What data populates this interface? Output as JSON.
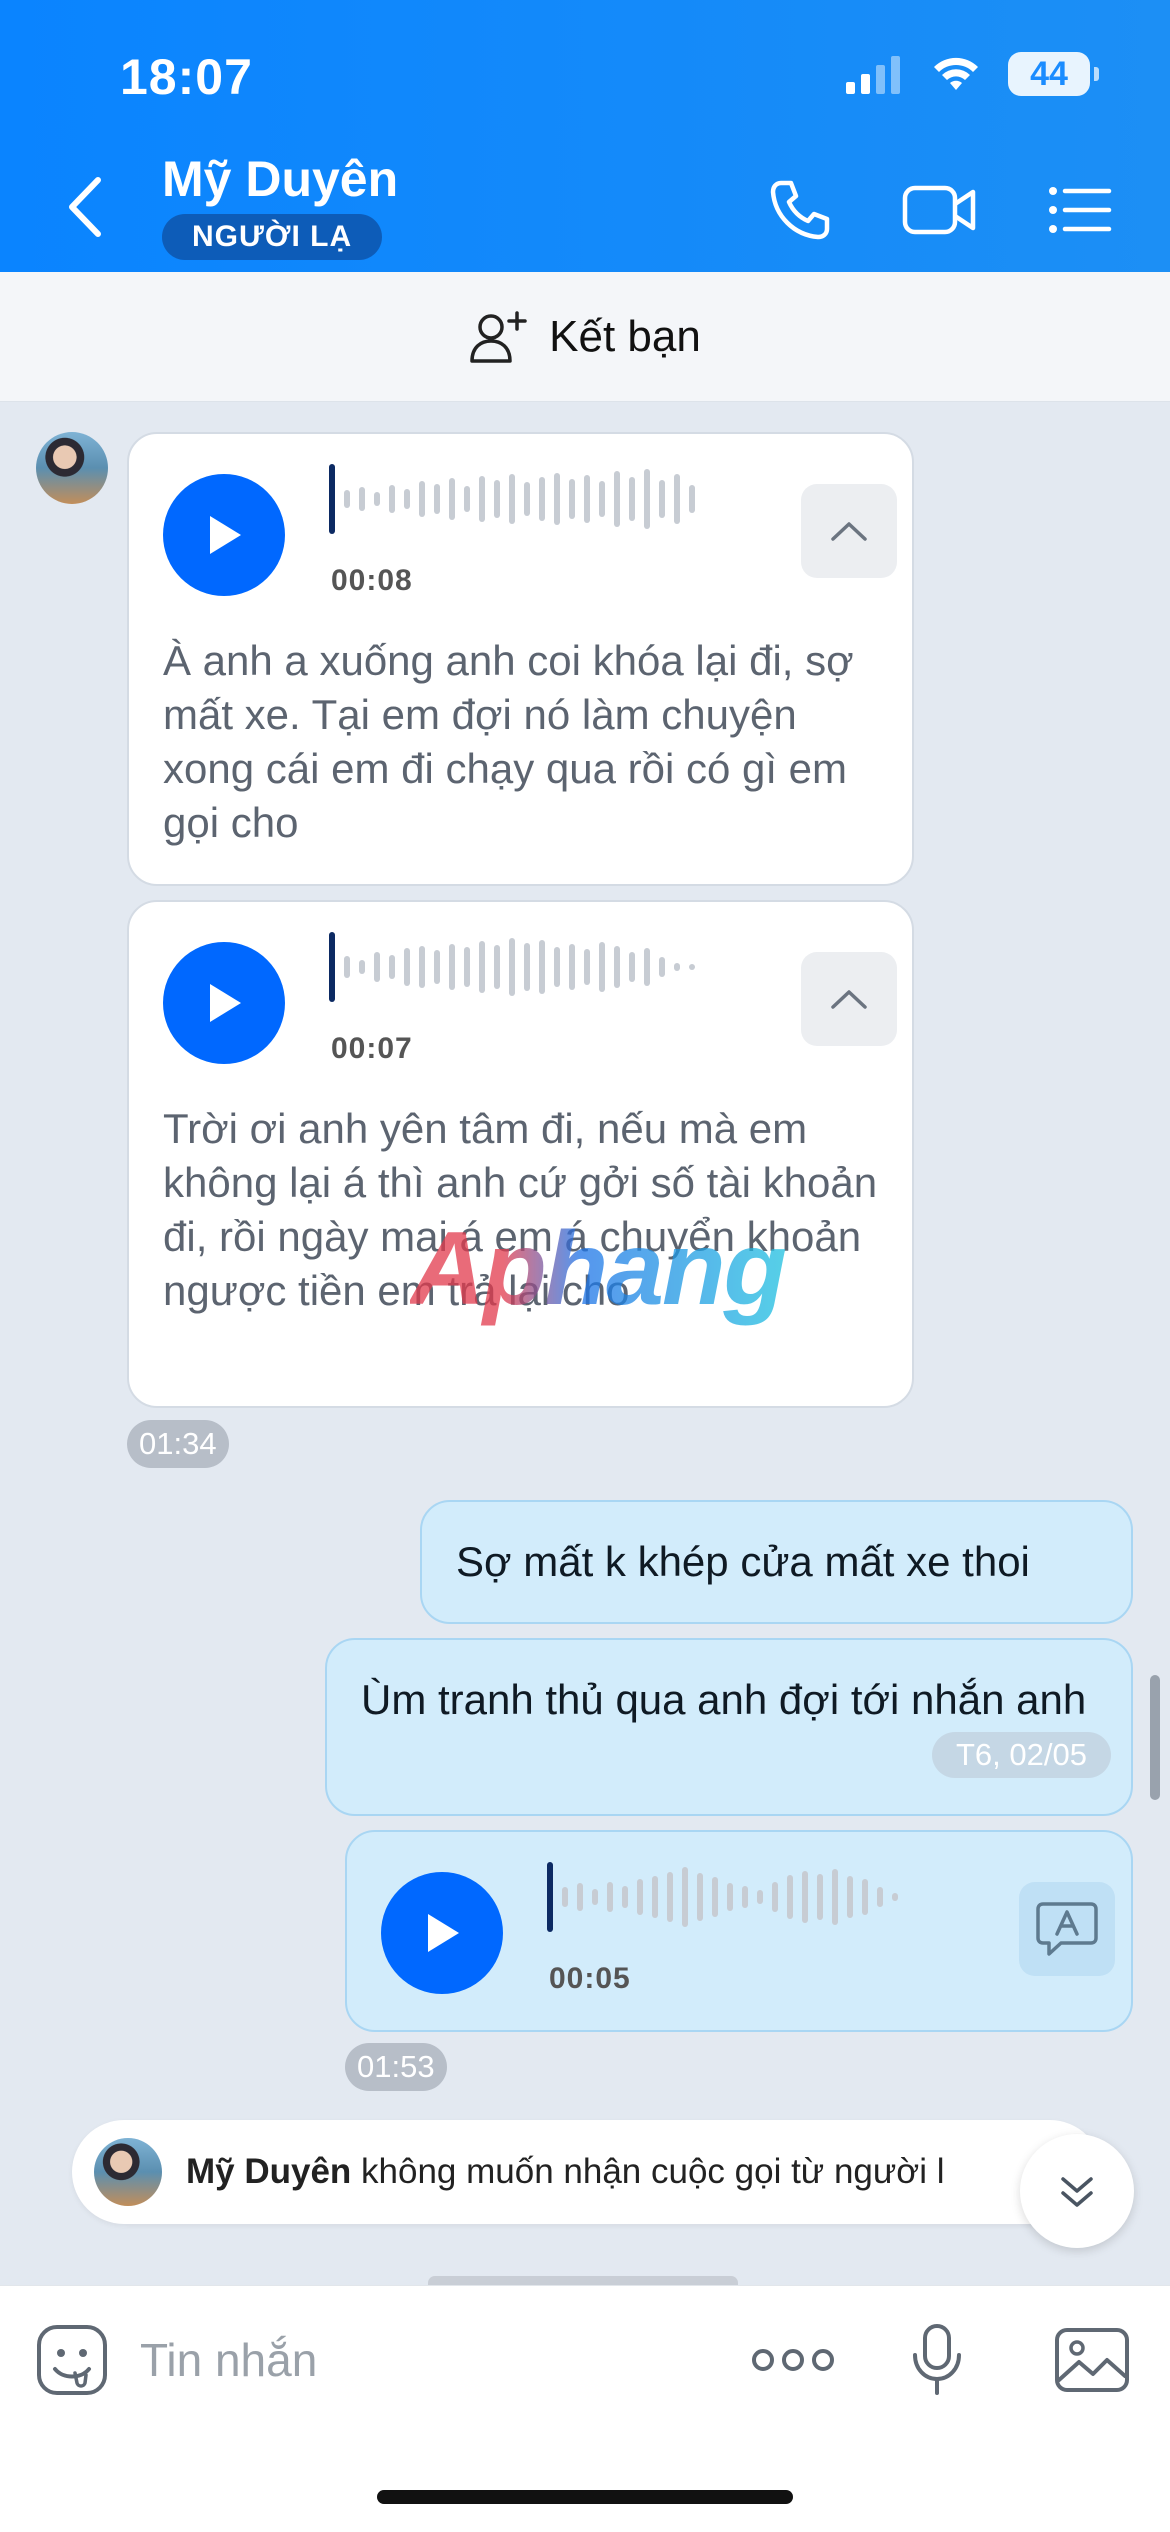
{
  "status_bar": {
    "time": "18:07",
    "battery": "44"
  },
  "header": {
    "contact_name": "Mỹ Duyên",
    "badge": "NGƯỜI LẠ"
  },
  "friend_bar": {
    "label": "Kết bạn"
  },
  "messages": {
    "voice1": {
      "duration": "00:08",
      "transcript": "À anh a xuống anh coi khóa lại đi, sợ mất xe. Tại em đợi nó làm chuyện xong cái em đi chạy qua rồi có gì em gọi cho"
    },
    "voice2": {
      "duration": "00:07",
      "transcript": "Trời ơi anh yên tâm đi, nếu mà em không lại á thì anh cứ gởi số tài khoản đi, rồi ngày mai á em á chuyển khoản ngược tiền em trả lại cho"
    },
    "time1": "01:34",
    "out1": "Sợ mất k khép cửa mất xe thoi",
    "out2": "Ùm tranh thủ qua anh đợi tới nhắn anh",
    "date_chip": "T6, 02/05",
    "voice3": {
      "duration": "00:05"
    },
    "time2": "01:53"
  },
  "notice": {
    "name": "Mỹ Duyên",
    "text": " không muốn nhận cuộc gọi từ người l"
  },
  "watermark": "Aphang",
  "composer": {
    "placeholder": "Tin nhắn"
  },
  "icons": [
    "back-icon",
    "phone-icon",
    "video-call-icon",
    "menu-list-icon",
    "add-friend-icon",
    "play-icon",
    "chevron-up-icon",
    "speech-to-text-icon",
    "chevron-down-icon",
    "sticker-icon",
    "more-icon",
    "microphone-icon",
    "image-icon"
  ],
  "colors": {
    "header_blue": "#0a84ff",
    "play_blue": "#0068ff",
    "badge_blue": "#0d5cb8",
    "outgoing_bubble": "#d2ecfb"
  }
}
